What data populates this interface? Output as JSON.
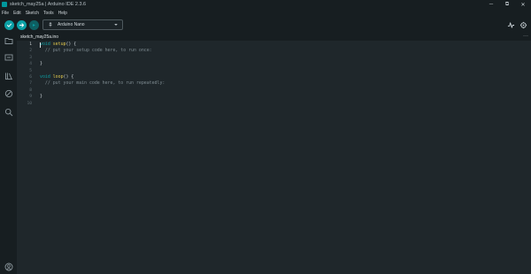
{
  "window": {
    "title": "sketch_may25a | Arduino IDE 2.3.6",
    "minimize": "─",
    "maximize": "⧉",
    "close": "✕"
  },
  "menu": [
    "File",
    "Edit",
    "Sketch",
    "Tools",
    "Help"
  ],
  "toolbar": {
    "board": "Arduino Nano"
  },
  "tab": {
    "name": "sketch_may25a.ino",
    "more": "···"
  },
  "editor": {
    "line_numbers": [
      "1",
      "2",
      "3",
      "4",
      "5",
      "6",
      "7",
      "8",
      "9",
      "10"
    ],
    "lines": [
      [
        {
          "t": "void",
          "c": "kw"
        },
        {
          "t": " ",
          "c": "pl"
        },
        {
          "t": "setup",
          "c": "fn"
        },
        {
          "t": "() {",
          "c": "pl"
        }
      ],
      [
        {
          "t": "  // put your setup code here, to run once:",
          "c": "cm"
        }
      ],
      [],
      [
        {
          "t": "}",
          "c": "pl"
        }
      ],
      [],
      [
        {
          "t": "void",
          "c": "kw"
        },
        {
          "t": " ",
          "c": "pl"
        },
        {
          "t": "loop",
          "c": "fn"
        },
        {
          "t": "() {",
          "c": "pl"
        }
      ],
      [
        {
          "t": "  // put your main code here, to run repeatedly:",
          "c": "cm"
        }
      ],
      [],
      [
        {
          "t": "}",
          "c": "pl"
        }
      ],
      []
    ]
  },
  "colors": {
    "accent": "#0ca1a6",
    "background": "#171e21",
    "editor_bg": "#1f272b"
  }
}
